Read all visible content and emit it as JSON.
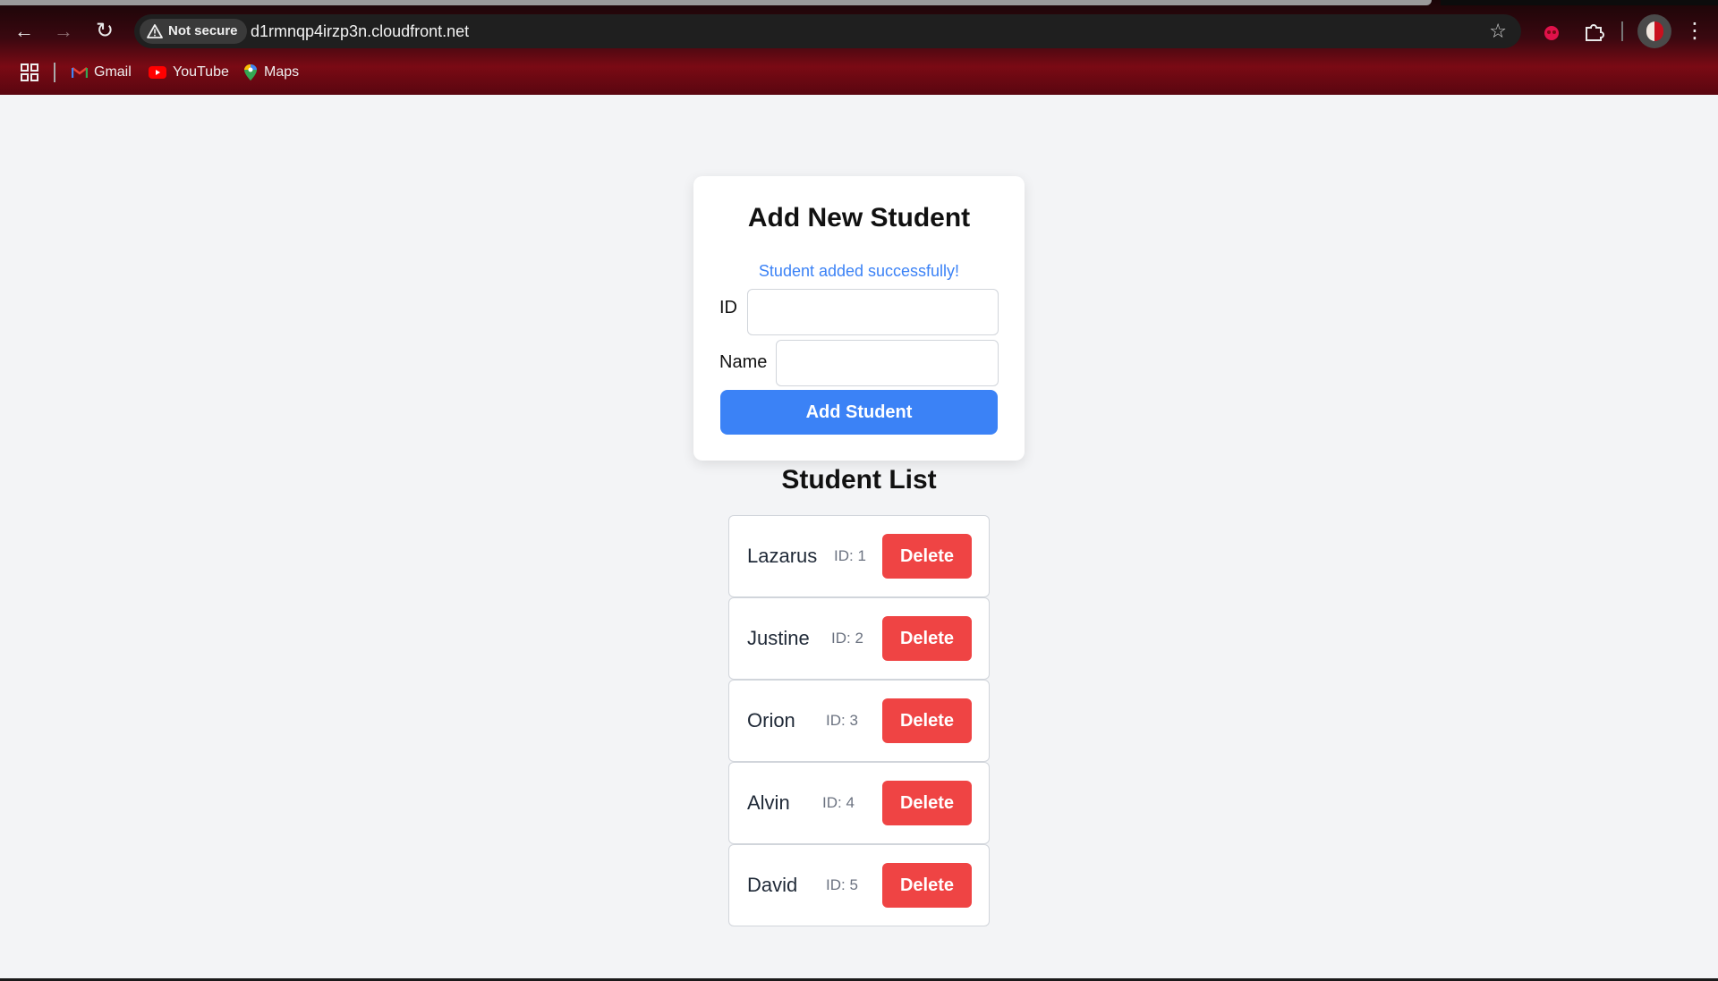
{
  "browser": {
    "security_label": "Not secure",
    "url": "d1rmnqp4irzp3n.cloudfront.net",
    "bookmarks": [
      {
        "label": "Gmail",
        "icon": "gmail-icon"
      },
      {
        "label": "YouTube",
        "icon": "youtube-icon"
      },
      {
        "label": "Maps",
        "icon": "maps-icon"
      }
    ]
  },
  "form": {
    "title": "Add New Student",
    "status_message": "Student added successfully!",
    "id_label": "ID",
    "id_value": "",
    "name_label": "Name",
    "name_value": "",
    "submit_label": "Add Student"
  },
  "list": {
    "title": "Student List",
    "delete_label": "Delete",
    "students": [
      {
        "name": "Lazarus",
        "id_text": "ID: 1"
      },
      {
        "name": "Justine",
        "id_text": "ID: 2"
      },
      {
        "name": "Orion",
        "id_text": "ID: 3"
      },
      {
        "name": "Alvin",
        "id_text": "ID: 4"
      },
      {
        "name": "David",
        "id_text": "ID: 5"
      }
    ]
  },
  "colors": {
    "primary": "#3b82f6",
    "danger": "#ef4444",
    "page_bg": "#f3f4f6"
  }
}
